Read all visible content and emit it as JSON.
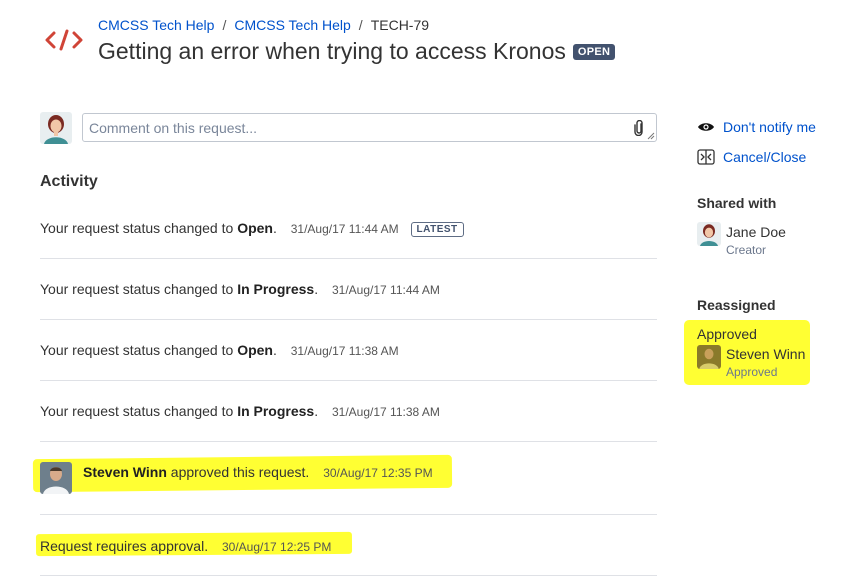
{
  "breadcrumb": {
    "project": "CMCSS Tech Help",
    "portal": "CMCSS Tech Help",
    "issue_key": "TECH-79",
    "separator": "/"
  },
  "request": {
    "title": "Getting an error when trying to access Kronos",
    "status_badge": "OPEN"
  },
  "comment": {
    "placeholder": "Comment on this request..."
  },
  "activity": {
    "heading": "Activity",
    "items": [
      {
        "prefix": "Your request status changed to",
        "status": "Open",
        "suffix": ".",
        "timestamp": "31/Aug/17 11:44 AM",
        "tag": "LATEST"
      },
      {
        "prefix": "Your request status changed to",
        "status": "In Progress",
        "suffix": ".",
        "timestamp": "31/Aug/17 11:44 AM"
      },
      {
        "prefix": "Your request status changed to",
        "status": "Open",
        "suffix": ".",
        "timestamp": "31/Aug/17 11:38 AM"
      },
      {
        "prefix": "Your request status changed to",
        "status": "In Progress",
        "suffix": ".",
        "timestamp": "31/Aug/17 11:38 AM"
      },
      {
        "actor": "Steven Winn",
        "text": "approved this request.",
        "timestamp": "30/Aug/17 12:35 PM"
      },
      {
        "text": "Request requires approval.",
        "timestamp": "30/Aug/17 12:25 PM"
      }
    ]
  },
  "sidebar": {
    "notify_label": "Don't notify me",
    "cancel_label": "Cancel/Close",
    "shared_with": {
      "heading": "Shared with",
      "name": "Jane Doe",
      "role": "Creator"
    },
    "reassigned": {
      "heading": "Reassigned",
      "status_label": "Approved",
      "name": "Steven Winn",
      "role": "Approved"
    }
  },
  "colors": {
    "link": "#0052cc",
    "highlight": "#ffff33",
    "badge": "#42526e",
    "logo": "#d04437"
  },
  "icons": [
    "code-logo-icon",
    "paperclip-icon",
    "eye-icon",
    "cancel-close-icon",
    "resize-handle-icon"
  ]
}
